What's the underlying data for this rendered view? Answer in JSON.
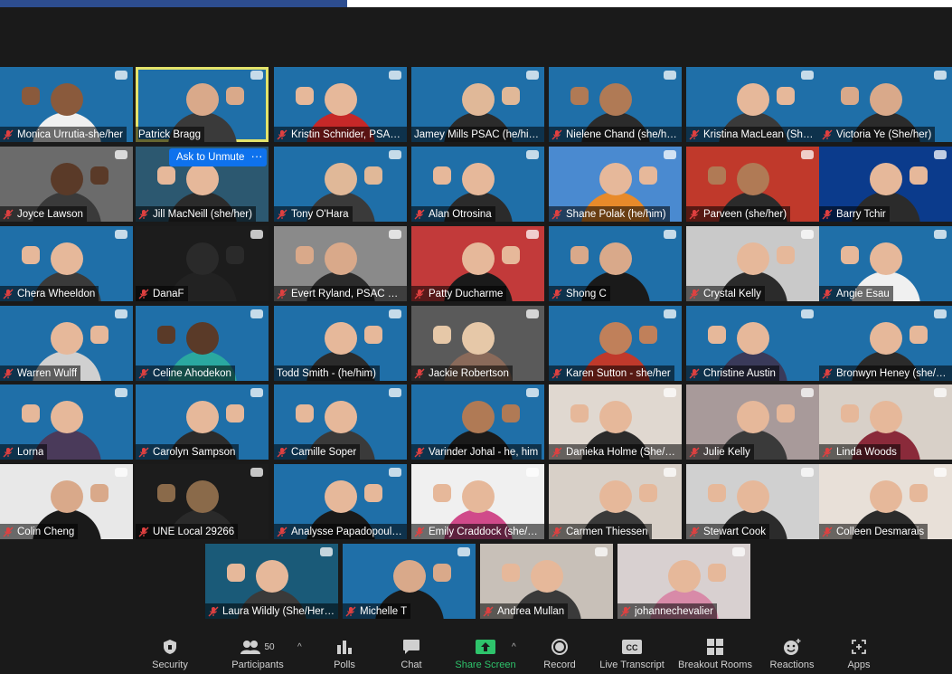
{
  "participants": [
    {
      "name": "Monica Urrutia-she/her",
      "bg": "#1f6fa8",
      "skin": "#8a5a3c",
      "shirt": "#f0f0f0",
      "muted": true
    },
    {
      "name": "Patrick Bragg",
      "bg": "#1f6fa8",
      "skin": "#d9a98a",
      "shirt": "#3a3a3a",
      "muted": false,
      "active": true
    },
    {
      "name": "Kristin Schnider, PSAC ...",
      "bg": "#1f6fa8",
      "skin": "#e6b89a",
      "shirt": "#c62828",
      "muted": true
    },
    {
      "name": "Jamey Mills PSAC (he/him...",
      "bg": "#1f6fa8",
      "skin": "#e0b898",
      "shirt": "#2b2b2b",
      "muted": false
    },
    {
      "name": "Nielene Chand (she/he...",
      "bg": "#1f6fa8",
      "skin": "#b07a55",
      "shirt": "#2b2b2b",
      "muted": true
    },
    {
      "name": "Kristina MacLean (She/...",
      "bg": "#1f6fa8",
      "skin": "#e6b89a",
      "shirt": "#3a3a3a",
      "muted": true
    },
    {
      "name": "Victoria Ye (She/her)",
      "bg": "#1f6fa8",
      "skin": "#d9a98a",
      "shirt": "#2b2b2b",
      "muted": true
    },
    {
      "name": "Joyce Lawson",
      "bg": "#6b6b6b",
      "skin": "#5a3a28",
      "shirt": "#3a3a3a",
      "muted": true
    },
    {
      "name": "Jill MacNeill (she/her)",
      "bg": "#2c5870",
      "skin": "#e6b89a",
      "shirt": "#2b2b2b",
      "muted": true
    },
    {
      "name": "Tony O'Hara",
      "bg": "#1f6fa8",
      "skin": "#e0b898",
      "shirt": "#3a3a3a",
      "muted": true
    },
    {
      "name": "Alan Otrosina",
      "bg": "#1f6fa8",
      "skin": "#e6b89a",
      "shirt": "#2b2b2b",
      "muted": true
    },
    {
      "name": "Shane Polak (he/him)",
      "bg": "#4a8ad0",
      "skin": "#e6b89a",
      "shirt": "#e88a2a",
      "muted": true
    },
    {
      "name": "Parveen (she/her)",
      "bg": "#c0392b",
      "skin": "#b07a55",
      "shirt": "#2b2b2b",
      "muted": true
    },
    {
      "name": "Barry Tchir",
      "bg": "#0b3b8c",
      "skin": "#e6b89a",
      "shirt": "#2b2b2b",
      "muted": true
    },
    {
      "name": "Chera Wheeldon",
      "bg": "#1f6fa8",
      "skin": "#e6b89a",
      "shirt": "#3a3a3a",
      "muted": true
    },
    {
      "name": "DanaF",
      "bg": "#1c1c1c",
      "skin": "#2a2a2a",
      "shirt": "#222",
      "muted": true
    },
    {
      "name": "Evert Ryland, PSAC Va...",
      "bg": "#8a8a8a",
      "skin": "#d9a98a",
      "shirt": "#2b2b2b",
      "muted": true
    },
    {
      "name": "Patty Ducharme",
      "bg": "#c23a3a",
      "skin": "#e6b89a",
      "shirt": "#1a1a1a",
      "muted": true
    },
    {
      "name": "Shong C",
      "bg": "#1f6fa8",
      "skin": "#d9a98a",
      "shirt": "#1a1a1a",
      "muted": true
    },
    {
      "name": "Crystal Kelly",
      "bg": "#c9c9c9",
      "skin": "#e6b89a",
      "shirt": "#2b2b2b",
      "muted": true
    },
    {
      "name": "Angie Esau",
      "bg": "#1f6fa8",
      "skin": "#e6b89a",
      "shirt": "#f0f0f0",
      "muted": true
    },
    {
      "name": "Warren Wulff",
      "bg": "#1f6fa8",
      "skin": "#e6b89a",
      "shirt": "#d0d0d0",
      "muted": true
    },
    {
      "name": "Celine Ahodekon",
      "bg": "#1f6fa8",
      "skin": "#5a3a28",
      "shirt": "#2aa8a0",
      "muted": true
    },
    {
      "name": "Todd Smith - (he/him)",
      "bg": "#1f6fa8",
      "skin": "#e6b89a",
      "shirt": "#2b2b2b",
      "muted": false
    },
    {
      "name": "Jackie Robertson",
      "bg": "#5a5a5a",
      "skin": "#e6c8a8",
      "shirt": "#8a6a5a",
      "muted": true
    },
    {
      "name": "Karen Sutton - she/her",
      "bg": "#1f6fa8",
      "skin": "#c0805a",
      "shirt": "#c0392b",
      "muted": true
    },
    {
      "name": "Christine Austin",
      "bg": "#1f6fa8",
      "skin": "#e6b89a",
      "shirt": "#3a3a5a",
      "muted": true
    },
    {
      "name": "Bronwyn Heney (she/h...",
      "bg": "#1f6fa8",
      "skin": "#e6b89a",
      "shirt": "#2b2b2b",
      "muted": true
    },
    {
      "name": "Lorna",
      "bg": "#1f6fa8",
      "skin": "#e6b89a",
      "shirt": "#4a3a5a",
      "muted": true
    },
    {
      "name": "Carolyn Sampson",
      "bg": "#1f6fa8",
      "skin": "#e6b89a",
      "shirt": "#2b2b2b",
      "muted": true
    },
    {
      "name": "Camille Soper",
      "bg": "#1f6fa8",
      "skin": "#e6b89a",
      "shirt": "#3a3a3a",
      "muted": true
    },
    {
      "name": "Varinder Johal - he, him",
      "bg": "#1f6fa8",
      "skin": "#b07a55",
      "shirt": "#1a1a1a",
      "muted": true
    },
    {
      "name": "Danieka Holme (She/H...",
      "bg": "#e0d8d0",
      "skin": "#e6b89a",
      "shirt": "#2b2b2b",
      "muted": true
    },
    {
      "name": "Julie Kelly",
      "bg": "#a89a9a",
      "skin": "#e6b89a",
      "shirt": "#3a3a3a",
      "muted": true
    },
    {
      "name": "Linda Woods",
      "bg": "#d8d0c8",
      "skin": "#e6b89a",
      "shirt": "#8a2a3a",
      "muted": true
    },
    {
      "name": "Colin Cheng",
      "bg": "#e8e8e8",
      "skin": "#d9a98a",
      "shirt": "#1a1a1a",
      "muted": true
    },
    {
      "name": "UNE Local 29266",
      "bg": "#1c1c1c",
      "skin": "#8a6a4a",
      "shirt": "#2a2a2a",
      "muted": true
    },
    {
      "name": "Analysse Papadopoulo...",
      "bg": "#1f6fa8",
      "skin": "#e6b89a",
      "shirt": "#1a1a1a",
      "muted": true
    },
    {
      "name": "Emily Craddock (she/h...",
      "bg": "#f0f0f0",
      "skin": "#e6b89a",
      "shirt": "#d04a8a",
      "muted": true
    },
    {
      "name": "Carmen Thiessen",
      "bg": "#d8d0c8",
      "skin": "#e6b89a",
      "shirt": "#3a3a3a",
      "muted": true
    },
    {
      "name": "Stewart Cook",
      "bg": "#d0d0d0",
      "skin": "#e6b89a",
      "shirt": "#2b2b2b",
      "muted": true
    },
    {
      "name": "Colleen Desmarais",
      "bg": "#e8e0d8",
      "skin": "#e6b89a",
      "shirt": "#2b2b2b",
      "muted": true
    },
    {
      "name": "Laura Wildly (She/Her/...",
      "bg": "#1a5a78",
      "skin": "#e6b89a",
      "shirt": "#3a3a3a",
      "muted": true
    },
    {
      "name": "Michelle T",
      "bg": "#1f6fa8",
      "skin": "#d9a98a",
      "shirt": "#1a1a1a",
      "muted": true
    },
    {
      "name": "Andrea Mullan",
      "bg": "#c8c0b8",
      "skin": "#e6b89a",
      "shirt": "#3a3a3a",
      "muted": true
    },
    {
      "name": "johannechevalier",
      "bg": "#d8d0d0",
      "skin": "#e6b89a",
      "shirt": "#d88aa8",
      "muted": true
    }
  ],
  "overlay": {
    "ask_unmute": "Ask to Unmute",
    "more": "···"
  },
  "toolbar": {
    "security": "Security",
    "participants": "Participants",
    "participants_count": "50",
    "polls": "Polls",
    "chat": "Chat",
    "share_screen": "Share Screen",
    "record": "Record",
    "live_transcript": "Live Transcript",
    "breakout_rooms": "Breakout Rooms",
    "reactions": "Reactions",
    "apps": "Apps"
  },
  "colors": {
    "active_speaker": "#e3e36a",
    "share_green": "#2ec36b",
    "muted_red": "#e04040",
    "accent_blue": "#0e72ed"
  }
}
